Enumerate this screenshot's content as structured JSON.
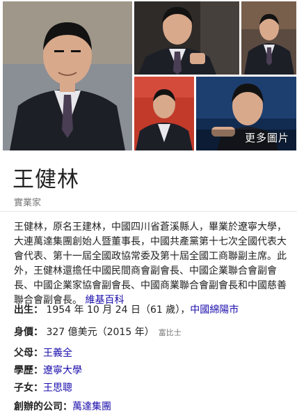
{
  "photos": {
    "more_label": "更多圖片",
    "palette": {
      "bg1": "#8a8e95",
      "bg2": "#2e2b29",
      "bg3": "#5b4a40",
      "bg4": "#c23a2a",
      "bg5": "#1d3f70",
      "suit": "#1d1f27",
      "skin": "#d9a98c",
      "hair": "#121212",
      "shirt": "#e8e8ec",
      "tie": "#4a3e54"
    }
  },
  "entity": {
    "name": "王健林",
    "subtitle": "實業家"
  },
  "description": {
    "text": "王健林，原名王建林，中國四川省蒼溪縣人，畢業於遼寧大學，大連萬達集團創始人暨董事長，中國共產黨第十七次全國代表大會代表、第十一屆全國政協常委及第十屆全國工商聯副主席。此外，王健林還擔任中國民間商會副會長、中國企業聯合會副會長、中國企業家協會副會長、中國商業聯合會副會長和中國慈善聯合會副會長。",
    "source_link": "維基百科"
  },
  "facts": {
    "birth": {
      "label": "出生：",
      "value": " 1954 年 10 月 24 日（61 歲），",
      "place": "中國綿陽市"
    },
    "net_worth": {
      "label": "身價：",
      "value": " 327 億美元（2015 年）",
      "source": "富比士"
    },
    "parents": {
      "label": "父母：",
      "link": "王義全"
    },
    "education": {
      "label": "學歷：",
      "link": "遼寧大學"
    },
    "children": {
      "label": "子女：",
      "link": "王思聰"
    },
    "founded": {
      "label": "創辦的公司：",
      "link": "萬達集團"
    }
  }
}
